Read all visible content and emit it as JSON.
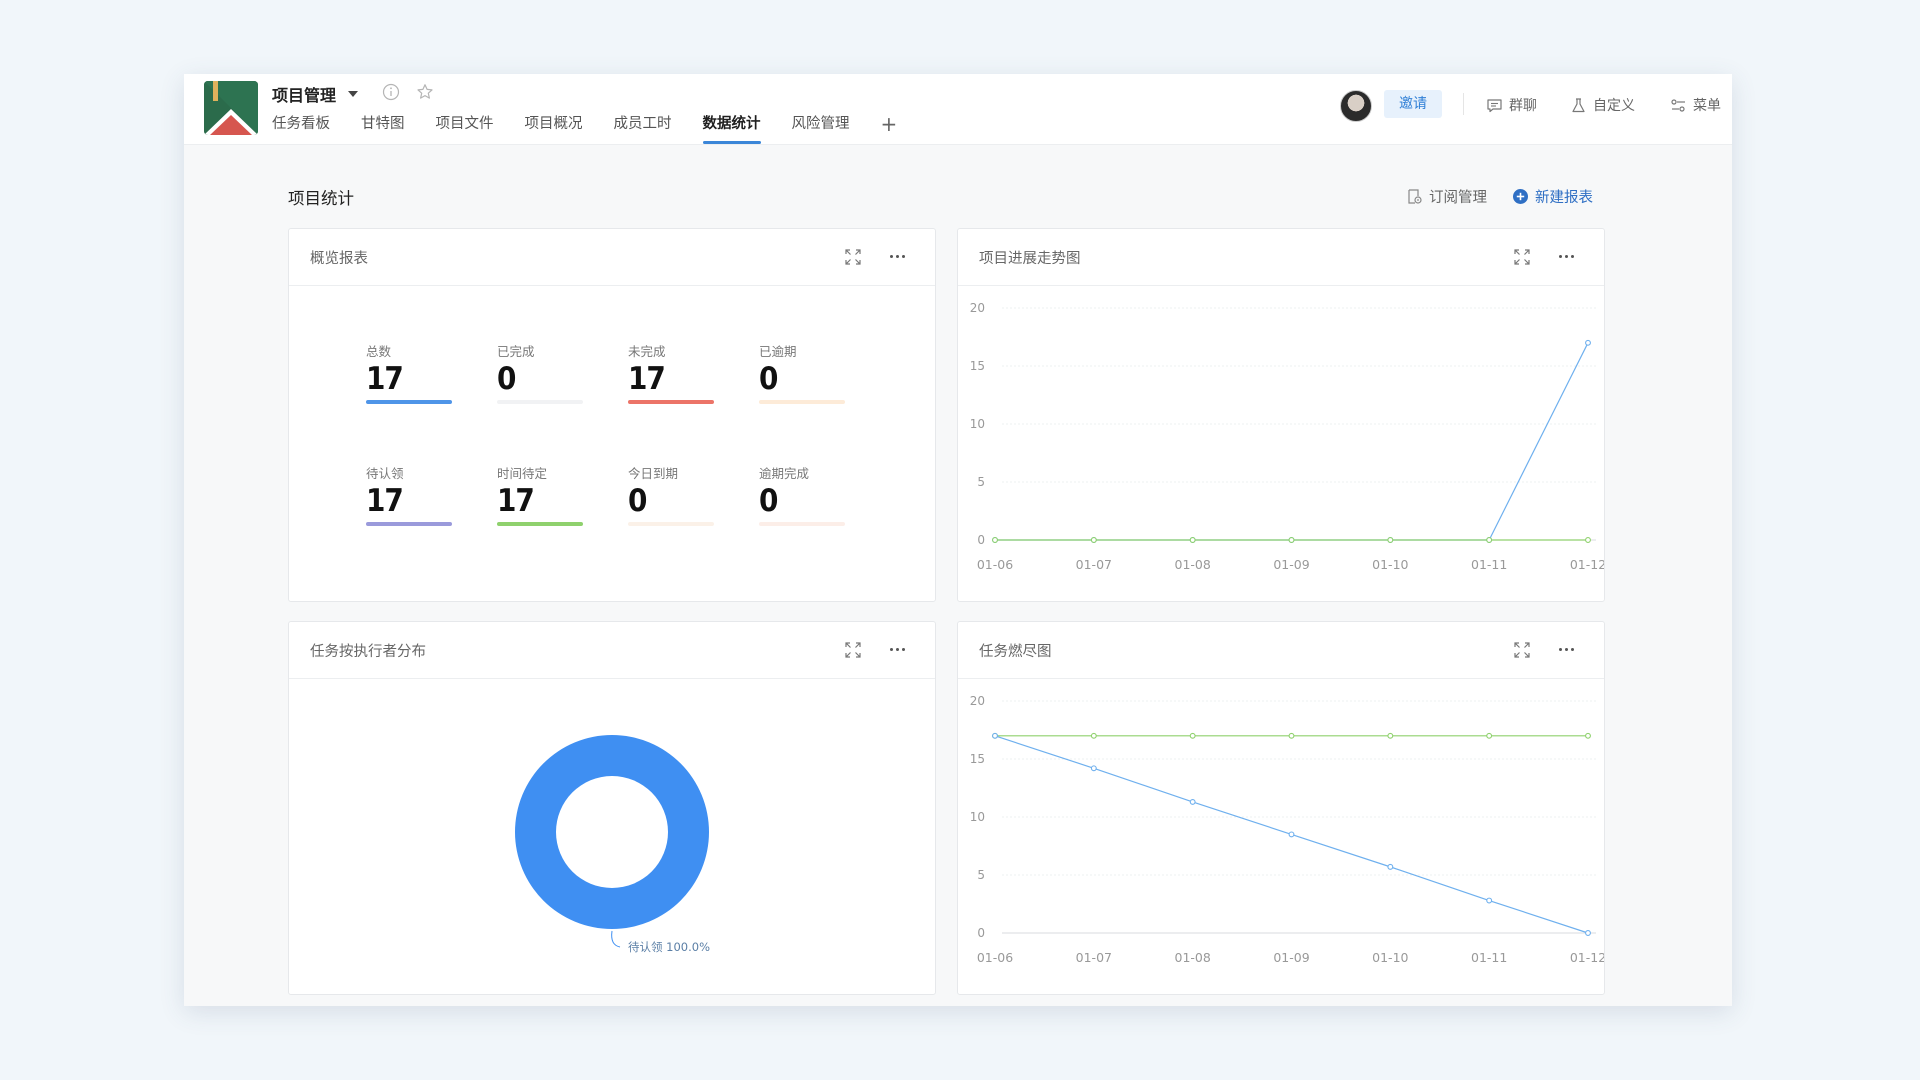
{
  "header": {
    "project_name": "项目管理",
    "tabs": [
      "任务看板",
      "甘特图",
      "项目文件",
      "项目概况",
      "成员工时",
      "数据统计",
      "风险管理"
    ],
    "active_tab": "数据统计",
    "invite_label": "邀请",
    "actions": [
      {
        "label": "群聊",
        "icon": "chat-icon"
      },
      {
        "label": "自定义",
        "icon": "flask-icon"
      },
      {
        "label": "菜单",
        "icon": "menu-settings-icon"
      }
    ]
  },
  "page": {
    "section_title": "项目统计",
    "subscribe_label": "订阅管理",
    "new_report_label": "新建报表"
  },
  "overview": {
    "title": "概览报表",
    "stats": [
      {
        "label": "总数",
        "value": "17",
        "color": "#4f95e8",
        "level": 1.0
      },
      {
        "label": "已完成",
        "value": "0",
        "color": "#f1f2f4",
        "level": 1.0
      },
      {
        "label": "未完成",
        "value": "17",
        "color": "#ec7468",
        "level": 1.0
      },
      {
        "label": "已逾期",
        "value": "0",
        "color": "#fdebd8",
        "level": 1.0
      },
      {
        "label": "待认领",
        "value": "17",
        "color": "#9a9adb",
        "level": 1.0
      },
      {
        "label": "时间待定",
        "value": "17",
        "color": "#8fd16d",
        "level": 1.0
      },
      {
        "label": "今日到期",
        "value": "0",
        "color": "#fbf1e8",
        "level": 1.0
      },
      {
        "label": "逾期完成",
        "value": "0",
        "color": "#fceee8",
        "level": 1.0
      }
    ]
  },
  "progress_card": {
    "title": "项目进展走势图"
  },
  "distribution_card": {
    "title": "任务按执行者分布"
  },
  "burndown_card": {
    "title": "任务燃尽图"
  },
  "chart_data": [
    {
      "type": "line",
      "title": "项目进展走势图",
      "x": [
        "01-06",
        "01-07",
        "01-08",
        "01-09",
        "01-10",
        "01-11",
        "01-12"
      ],
      "ylim": [
        0,
        20
      ],
      "yticks": [
        0,
        5,
        10,
        15,
        20
      ],
      "grid": true,
      "series": [
        {
          "values": [
            0,
            0,
            0,
            0,
            0,
            0,
            17
          ],
          "color": "#6fb0ee"
        },
        {
          "values": [
            0,
            0,
            0,
            0,
            0,
            0,
            0
          ],
          "color": "#8fd16d"
        }
      ]
    },
    {
      "type": "pie",
      "title": "任务按执行者分布",
      "slices": [
        {
          "label": "待认领",
          "value": 100.0,
          "display": "待认领 100.0%",
          "color": "#3f8ff2"
        }
      ]
    },
    {
      "type": "line",
      "title": "任务燃尽图",
      "x": [
        "01-06",
        "01-07",
        "01-08",
        "01-09",
        "01-10",
        "01-11",
        "01-12"
      ],
      "ylim": [
        0,
        20
      ],
      "yticks": [
        0,
        5,
        10,
        15,
        20
      ],
      "grid": true,
      "series": [
        {
          "values": [
            17,
            17,
            17,
            17,
            17,
            17,
            17
          ],
          "color": "#8fd16d"
        },
        {
          "values": [
            17,
            14.2,
            11.3,
            8.5,
            5.7,
            2.8,
            0
          ],
          "color": "#6fb0ee"
        }
      ]
    }
  ]
}
